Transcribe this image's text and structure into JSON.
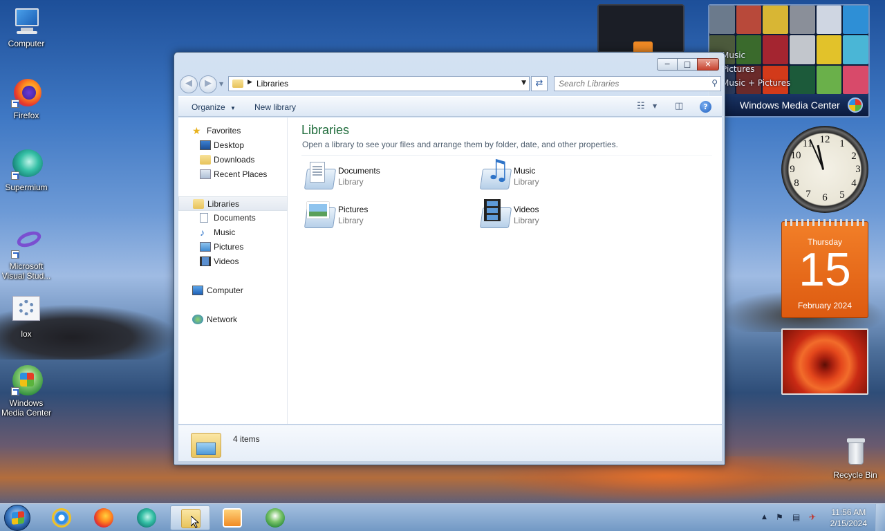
{
  "desktop": {
    "icons": [
      {
        "label": "Computer"
      },
      {
        "label": "Firefox"
      },
      {
        "label": "Supermium"
      },
      {
        "label": "Microsoft Visual Stud..."
      },
      {
        "label": "lox"
      },
      {
        "label": "Windows Media Center"
      },
      {
        "label": "Recycle Bin"
      }
    ]
  },
  "gadgets": {
    "media_center": {
      "items": [
        "Music",
        "Pictures",
        "Music + Pictures"
      ],
      "title": "Windows Media Center"
    },
    "clock": {
      "numbers": [
        "12",
        "1",
        "2",
        "3",
        "4",
        "5",
        "6",
        "7",
        "8",
        "9",
        "10",
        "11"
      ]
    },
    "calendar": {
      "weekday": "Thursday",
      "day": "15",
      "month": "February 2024"
    }
  },
  "window": {
    "address": {
      "crumb": "Libraries"
    },
    "search": {
      "placeholder": "Search Libraries"
    },
    "toolbar": {
      "organize": "Organize",
      "new_library": "New library"
    },
    "nav": {
      "favorites": "Favorites",
      "desktop": "Desktop",
      "downloads": "Downloads",
      "recent": "Recent Places",
      "libraries": "Libraries",
      "documents": "Documents",
      "music": "Music",
      "pictures": "Pictures",
      "videos": "Videos",
      "computer": "Computer",
      "network": "Network"
    },
    "main": {
      "title": "Libraries",
      "subtitle": "Open a library to see your files and arrange them by folder, date, and other properties.",
      "items": [
        {
          "name": "Documents",
          "kind": "Library"
        },
        {
          "name": "Music",
          "kind": "Library"
        },
        {
          "name": "Pictures",
          "kind": "Library"
        },
        {
          "name": "Videos",
          "kind": "Library"
        }
      ]
    },
    "details": {
      "count": "4 items"
    }
  },
  "taskbar": {
    "clock_time": "11:56 AM",
    "clock_date": "2/15/2024"
  },
  "colors": {
    "accent_green": "#1e6b3a",
    "calendar_orange": "#e8661a",
    "close_red": "#c7432f"
  }
}
